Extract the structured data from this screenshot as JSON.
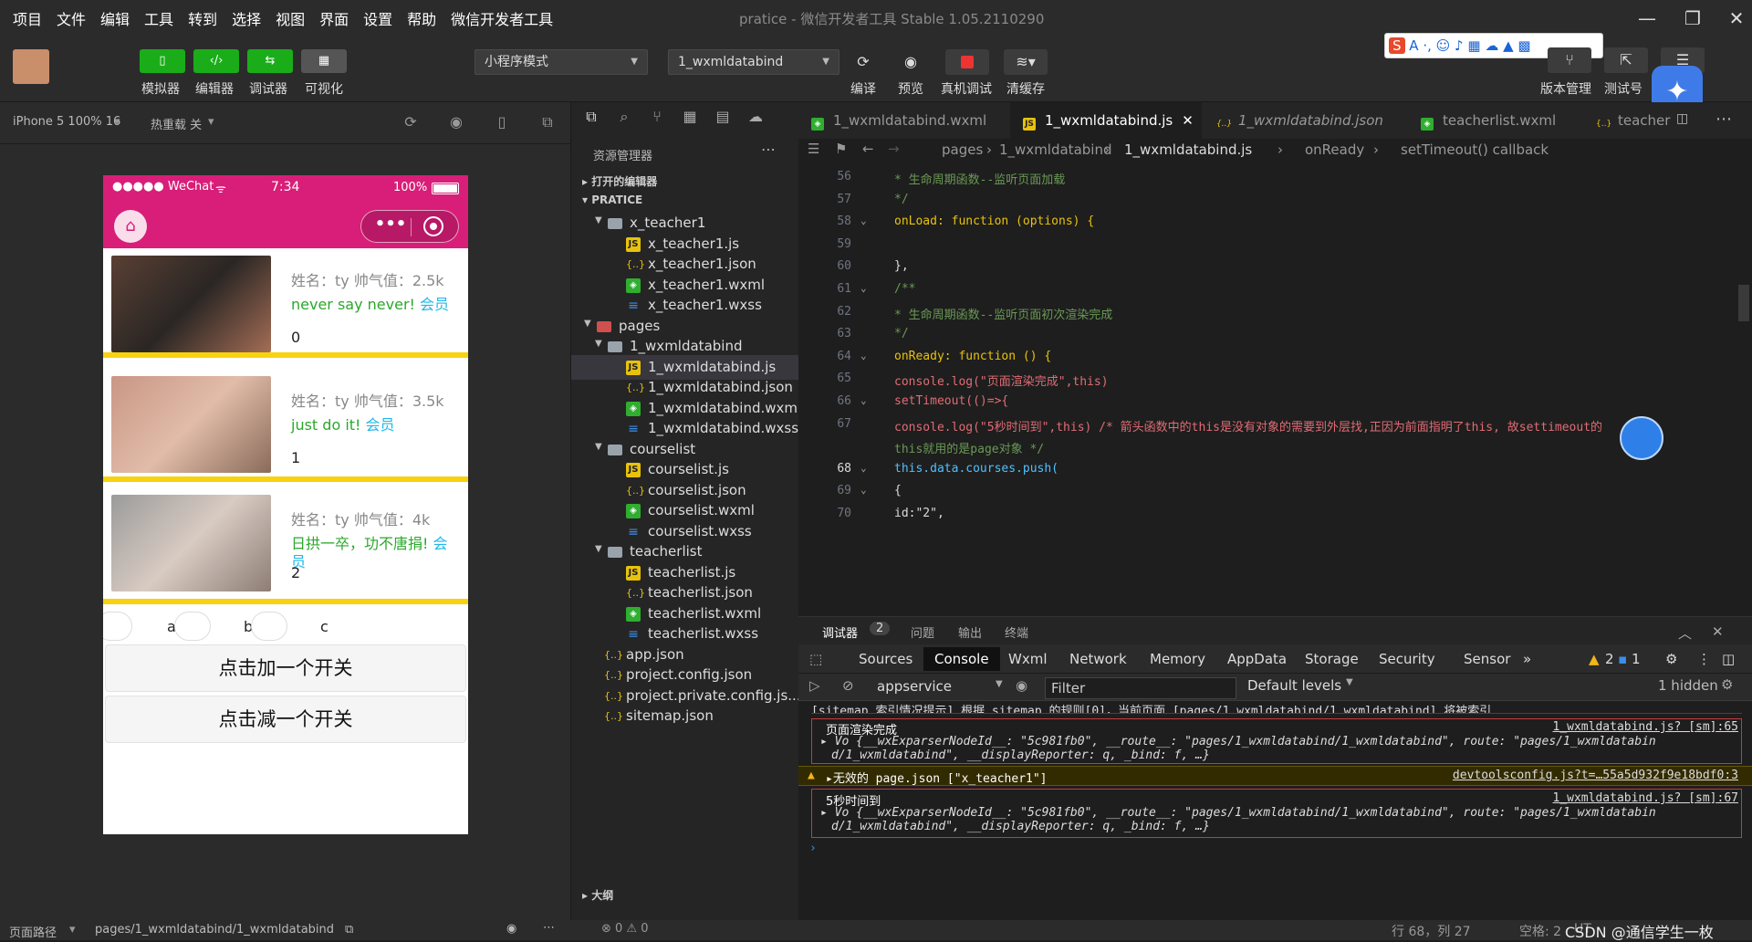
{
  "menu": [
    "项目",
    "文件",
    "编辑",
    "工具",
    "转到",
    "选择",
    "视图",
    "界面",
    "设置",
    "帮助",
    "微信开发者工具"
  ],
  "window_title": "pratice - 微信开发者工具 Stable 1.05.2110290",
  "toolbar": {
    "simulator": "模拟器",
    "editor": "编辑器",
    "debugger": "调试器",
    "visual": "可视化",
    "mode_select": "小程序模式",
    "page_select": "1_wxmldatabind",
    "compile": "编译",
    "preview": "预览",
    "real_debug": "真机调试",
    "clear_cache": "清缓存",
    "version": "版本管理",
    "test": "测试号"
  },
  "sim": {
    "device": "iPhone 5 100% 16",
    "hot_reload": "热重载 关",
    "status_left": "●●●●● WeChat",
    "status_time": "7:34",
    "status_battery": "100%",
    "cards": [
      {
        "name": "姓名：ty 帅气值：2.5k",
        "motto": "never say never!",
        "vip": "会员",
        "num": "0"
      },
      {
        "name": "姓名：ty 帅气值：3.5k",
        "motto": "just do it!",
        "vip": "会员",
        "num": "1"
      },
      {
        "name": "姓名：ty 帅气值：4k",
        "motto": "日拱一卒，功不唐捐!",
        "vip": "会员",
        "num": "2"
      }
    ],
    "switch_labels": [
      "a",
      "b",
      "c"
    ],
    "add_button": "点击加一个开关",
    "remove_button": "点击减一个开关",
    "footer_path_label": "页面路径",
    "footer_path": "pages/1_wxmldatabind/1_wxmldatabind"
  },
  "explorer": {
    "title": "资源管理器",
    "open_editors": "打开的编辑器",
    "project": "PRATICE",
    "outline": "大纲",
    "status": "⊗ 0 ⚠ 0",
    "items": [
      {
        "label": "x_teacher1",
        "type": "folder",
        "depth": 1
      },
      {
        "label": "x_teacher1.js",
        "type": "js",
        "depth": 2
      },
      {
        "label": "x_teacher1.json",
        "type": "json",
        "depth": 2
      },
      {
        "label": "x_teacher1.wxml",
        "type": "wxml",
        "depth": 2
      },
      {
        "label": "x_teacher1.wxss",
        "type": "wxss",
        "depth": 2
      },
      {
        "label": "pages",
        "type": "folderred",
        "depth": 0
      },
      {
        "label": "1_wxmldatabind",
        "type": "folder",
        "depth": 1
      },
      {
        "label": "1_wxmldatabind.js",
        "type": "js",
        "depth": 2,
        "selected": true
      },
      {
        "label": "1_wxmldatabind.json",
        "type": "json",
        "depth": 2
      },
      {
        "label": "1_wxmldatabind.wxml",
        "type": "wxml",
        "depth": 2
      },
      {
        "label": "1_wxmldatabind.wxss",
        "type": "wxss",
        "depth": 2
      },
      {
        "label": "courselist",
        "type": "folder",
        "depth": 1
      },
      {
        "label": "courselist.js",
        "type": "js",
        "depth": 2
      },
      {
        "label": "courselist.json",
        "type": "json",
        "depth": 2
      },
      {
        "label": "courselist.wxml",
        "type": "wxml",
        "depth": 2
      },
      {
        "label": "courselist.wxss",
        "type": "wxss",
        "depth": 2
      },
      {
        "label": "teacherlist",
        "type": "folder",
        "depth": 1
      },
      {
        "label": "teacherlist.js",
        "type": "js",
        "depth": 2
      },
      {
        "label": "teacherlist.json",
        "type": "json",
        "depth": 2
      },
      {
        "label": "teacherlist.wxml",
        "type": "wxml",
        "depth": 2
      },
      {
        "label": "teacherlist.wxss",
        "type": "wxss",
        "depth": 2
      },
      {
        "label": "app.json",
        "type": "json",
        "depth": 0
      },
      {
        "label": "project.config.json",
        "type": "json",
        "depth": 0
      },
      {
        "label": "project.private.config.js...",
        "type": "json",
        "depth": 0
      },
      {
        "label": "sitemap.json",
        "type": "json",
        "depth": 0
      }
    ]
  },
  "editor": {
    "tabs": [
      {
        "label": "1_wxmldatabind.wxml",
        "type": "wxml"
      },
      {
        "label": "1_wxmldatabind.js",
        "type": "js",
        "active": true
      },
      {
        "label": "1_wxmldatabind.json",
        "type": "json"
      },
      {
        "label": "teacherlist.wxml",
        "type": "wxml"
      },
      {
        "label": "teacher",
        "type": "json"
      }
    ],
    "breadcrumb": [
      "pages",
      "1_wxmldatabind",
      "1_wxmldatabind.js",
      "onReady",
      "setTimeout() callback"
    ],
    "lines": [
      {
        "n": "56",
        "text": " * 生命周期函数--监听页面加载"
      },
      {
        "n": "57",
        "text": " */"
      },
      {
        "n": "58",
        "text": "onLoad: function (options) {"
      },
      {
        "n": "59",
        "text": ""
      },
      {
        "n": "60",
        "text": "},"
      },
      {
        "n": "61",
        "text": "/**"
      },
      {
        "n": "62",
        "text": " * 生命周期函数--监听页面初次渲染完成"
      },
      {
        "n": "63",
        "text": " */"
      },
      {
        "n": "64",
        "text": "onReady: function () {"
      },
      {
        "n": "65",
        "text": "  console.log(\"页面渲染完成\",this)"
      },
      {
        "n": "66",
        "text": "  setTimeout(()=>{"
      },
      {
        "n": "67",
        "text": "    console.log(\"5秒时间到\",this) /* 箭头函数中的this是没有对象的需要到外层找,正因为前面指明了this, 故settimeout的"
      },
      {
        "n": "",
        "text": "    this就用的是page对象 */"
      },
      {
        "n": "68",
        "text": "  this.data.courses.push("
      },
      {
        "n": "69",
        "text": "  {"
      },
      {
        "n": "70",
        "text": "    id:\"2\","
      }
    ]
  },
  "debug": {
    "tab_debugger": "调试器",
    "badge": "2",
    "tab_issues": "问题",
    "tab_output": "输出",
    "tab_terminal": "终端",
    "devtabs": [
      "Sources",
      "Console",
      "Wxml",
      "Network",
      "Memory",
      "AppData",
      "Storage",
      "Security",
      "Sensor"
    ],
    "warn_count": "2",
    "info_count": "1",
    "context": "appservice",
    "filter_placeholder": "Filter",
    "levels": "Default levels",
    "hidden": "1 hidden",
    "logs": {
      "sitemap": "[sitemap 索引情况提示] 根据 sitemap 的规则[0]，当前页面 [pages/1_wxmldatabind/1_wxmldatabind] 将被索引",
      "render_title": "页面渲染完成",
      "render_src": "1_wxmldatabind.js? [sm]:65",
      "obj1": "Vo {__wxExparserNodeId__: \"5c981fb0\", __route__: \"pages/1_wxmldatabind/1_wxmldatabind\", route: \"pages/1_wxmldatabin",
      "obj1b": "d/1_wxmldatabind\", __displayReporter: q, _bind: f, …}",
      "warn_text": "无效的 page.json [\"x_teacher1\"]",
      "warn_src": "devtoolsconfig.js?t=…55a5d932f9e18bdf0:3",
      "timer_title": "5秒时间到",
      "timer_src": "1_wxmldatabind.js? [sm]:67",
      "obj2": "Vo {__wxExparserNodeId__: \"5c981fb0\", __route__: \"pages/1_wxmldatabind/1_wxmldatabind\", route: \"pages/1_wxmldatabin",
      "obj2b": "d/1_wxmldatabind\", __displayReporter: q, _bind: f, …}"
    }
  },
  "statusbar": {
    "position": "行 68，列 27",
    "spaces": "空格: 2",
    "encoding": "UT",
    "watermark": "CSDN @通信学生一枚"
  }
}
